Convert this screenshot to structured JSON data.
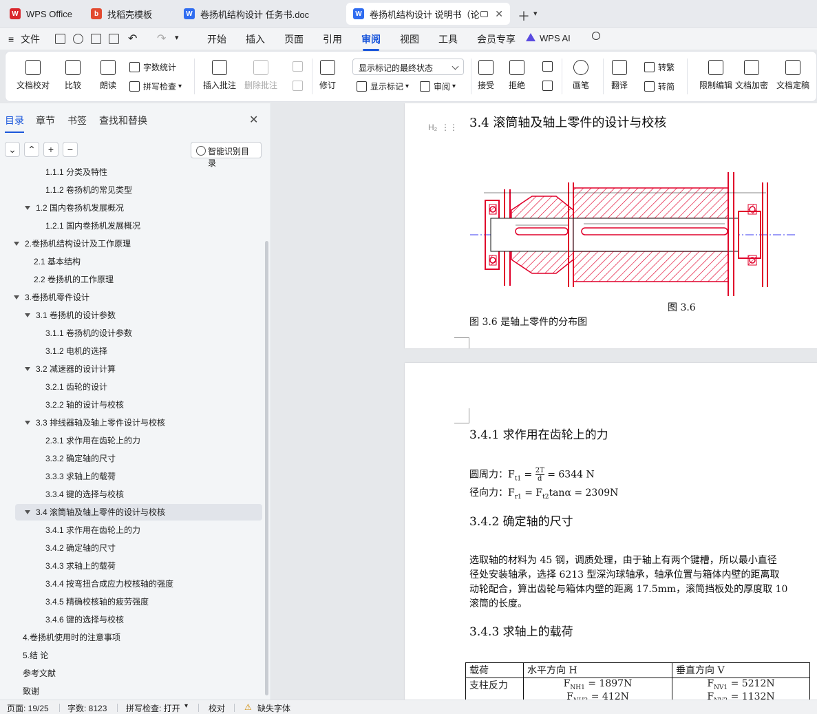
{
  "tabs": [
    {
      "label": "WPS Office"
    },
    {
      "label": "找稻壳模板"
    },
    {
      "label": "卷扬机结构设计 任务书.doc"
    },
    {
      "label": "卷扬机结构设计 说明书（论文"
    }
  ],
  "menu": {
    "file": "文件",
    "items": [
      "开始",
      "插入",
      "页面",
      "引用",
      "审阅",
      "视图",
      "工具",
      "会员专享"
    ],
    "active": "审阅",
    "wps_ai": "WPS AI"
  },
  "ribbon": {
    "proofread": "文档校对",
    "compare": "比较",
    "read_aloud": "朗读",
    "word_count": "字数统计",
    "spell_check": "拼写检查",
    "insert_comment": "插入批注",
    "delete_comment": "删除批注",
    "track": "修订",
    "markup_state": "显示标记的最终状态",
    "show_markup": "显示标记",
    "review": "审阅",
    "accept": "接受",
    "reject": "拒绝",
    "ink": "画笔",
    "translate": "翻译",
    "to_traditional": "转繁",
    "to_simplified": "转简",
    "restrict_edit": "限制编辑",
    "encrypt": "文档加密",
    "finalize": "文档定稿"
  },
  "panel": {
    "tabs": [
      "目录",
      "章节",
      "书签",
      "查找和替换"
    ],
    "active_tab": "目录",
    "smart_toc": "智能识别目录",
    "toc": [
      {
        "text": "1.1.1   分类及特性",
        "level": 3
      },
      {
        "text": "1.1.2   卷扬机的常见类型",
        "level": 3
      },
      {
        "text": "1.2   国内卷扬机发展概况",
        "level": 2,
        "expand": true
      },
      {
        "text": "1.2.1   国内卷扬机发展概况",
        "level": 3
      },
      {
        "text": "2.卷扬机结构设计及工作原理",
        "level": 1,
        "expand": true
      },
      {
        "text": "2.1  基本结构",
        "level": 2
      },
      {
        "text": "2.2  卷扬机的工作原理",
        "level": 2
      },
      {
        "text": "3.卷扬机零件设计",
        "level": 1,
        "expand": true
      },
      {
        "text": "3.1  卷扬机的设计参数",
        "level": 2,
        "expand": true
      },
      {
        "text": "3.1.1  卷扬机的设计参数",
        "level": 3
      },
      {
        "text": "3.1.2  电机的选择",
        "level": 3
      },
      {
        "text": "3.2  减速器的设计计算",
        "level": 2,
        "expand": true
      },
      {
        "text": "3.2.1 齿轮的设计",
        "level": 3
      },
      {
        "text": "3.2.2  轴的设计与校核",
        "level": 3
      },
      {
        "text": "3.3  排线器轴及轴上零件设计与校核",
        "level": 2,
        "expand": true
      },
      {
        "text": "2.3.1 求作用在齿轮上的力",
        "level": 3
      },
      {
        "text": "3.3.2  确定轴的尺寸",
        "level": 3
      },
      {
        "text": "3.3.3  求轴上的载荷",
        "level": 3
      },
      {
        "text": "3.3.4  键的选择与校核",
        "level": 3
      },
      {
        "text": "3.4 滚筒轴及轴上零件的设计与校核",
        "level": 2,
        "expand": true,
        "selected": true
      },
      {
        "text": "3.4.1  求作用在齿轮上的力",
        "level": 3
      },
      {
        "text": "3.4.2  确定轴的尺寸",
        "level": 3
      },
      {
        "text": "3.4.3  求轴上的载荷",
        "level": 3
      },
      {
        "text": "3.4.4  按弯扭合成应力校核轴的强度",
        "level": 3
      },
      {
        "text": "3.4.5 精确校核轴的疲劳强度",
        "level": 3
      },
      {
        "text": "3.4.6  键的选择与校核",
        "level": 3
      },
      {
        "text": "4.卷扬机使用时的注意事项",
        "level": 1
      },
      {
        "text": "5.结  论",
        "level": 1
      },
      {
        "text": "参考文献",
        "level": 1
      },
      {
        "text": "致谢",
        "level": 1
      }
    ]
  },
  "doc": {
    "marker": "H₂",
    "heading_34": "3.4 滚筒轴及轴上零件的设计与校核",
    "figure_label": "图 3.6",
    "figure_text": "图 3.6 是轴上零件的分布图",
    "heading_341": "3.4.1  求作用在齿轮上的力",
    "ft_label": "圆周力：",
    "ft_expr": "= 6344 N",
    "fr_label": "径向力：",
    "fr_expr": "= F",
    "fr_tail": "tanα = 2309N",
    "heading_342": "3.4.2  确定轴的尺寸",
    "para": [
      "选取轴的材料为 45 钢，调质处理，由于轴上有两个键槽，所以最小直径",
      "径处安装轴承，选择 6213 型深沟球轴承，轴承位置与箱体内壁的距离取",
      "动轮配合，算出齿轮与箱体内壁的距离 17.5mm，滚筒挡板处的厚度取 10",
      "滚筒的长度。"
    ],
    "heading_343": "3.4.3  求轴上的载荷",
    "table": {
      "h": [
        "载荷",
        "水平方向 H",
        "垂直方向 V"
      ],
      "r1": [
        "支柱反力",
        "F",
        "= 1897N",
        "F",
        "= 5212N"
      ],
      "r2": [
        "F",
        "= 412N",
        "F",
        "= 1132N"
      ]
    }
  },
  "status": {
    "page": "页面: 19/25",
    "words": "字数: 8123",
    "spell": "拼写检查: 打开",
    "proof": "校对",
    "missing_font": "缺失字体"
  }
}
